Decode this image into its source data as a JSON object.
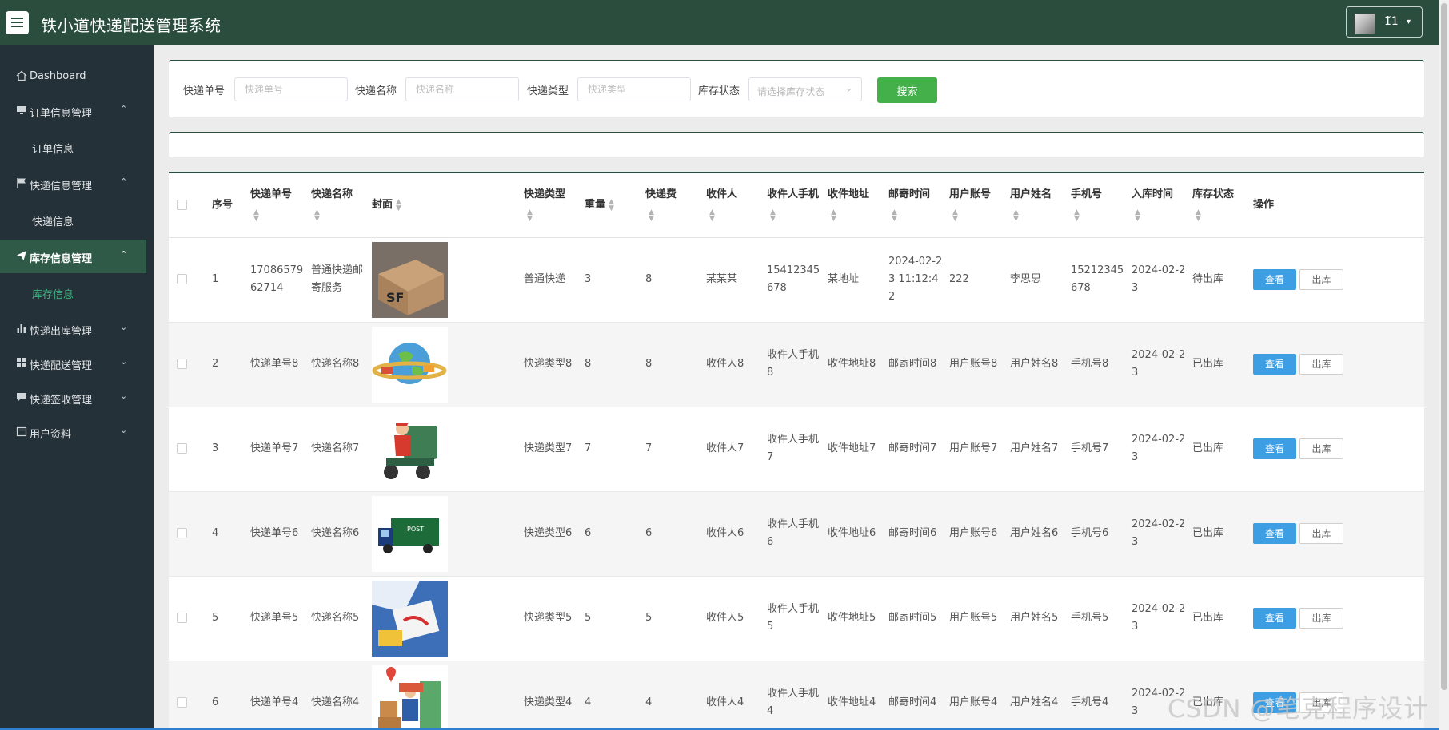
{
  "header": {
    "title": "铁小道快递配送管理系统",
    "user_name": "1̃1",
    "user_caret": "▾"
  },
  "sidebar": {
    "items": [
      {
        "label": "Dashboard",
        "icon": "home-icon"
      },
      {
        "label": "订单信息管理",
        "icon": "monitor-icon",
        "expanded": true
      },
      {
        "label": "订单信息",
        "sub": true
      },
      {
        "label": "快递信息管理",
        "icon": "flag-icon",
        "expanded": true
      },
      {
        "label": "快递信息",
        "sub": true
      },
      {
        "label": "库存信息管理",
        "icon": "send-icon",
        "expanded": true,
        "active": true
      },
      {
        "label": "库存信息",
        "sub": true,
        "current": true
      },
      {
        "label": "快递出库管理",
        "icon": "bar-chart-icon"
      },
      {
        "label": "快递配送管理",
        "icon": "grid-icon"
      },
      {
        "label": "快递签收管理",
        "icon": "comment-icon"
      },
      {
        "label": "用户资料",
        "icon": "calendar-icon"
      }
    ],
    "chevron_up": "⌃",
    "chevron_down": "⌄"
  },
  "search": {
    "fields": [
      {
        "label": "快递单号",
        "placeholder": "快递单号"
      },
      {
        "label": "快递名称",
        "placeholder": "快递名称"
      },
      {
        "label": "快递类型",
        "placeholder": "快递类型"
      }
    ],
    "status_label": "库存状态",
    "status_placeholder": "请选择库存状态",
    "button": "搜索"
  },
  "table": {
    "columns": [
      "序号",
      "快递单号",
      "快递名称",
      "封面",
      "快递类型",
      "重量",
      "快递费",
      "收件人",
      "收件人手机",
      "收件地址",
      "邮寄时间",
      "用户账号",
      "用户姓名",
      "手机号",
      "入库时间",
      "库存状态",
      "操作"
    ],
    "view_label": "查看",
    "out_label": "出库",
    "rows": [
      {
        "no": "1",
        "code": "1708657962714",
        "name": "普通快递邮寄服务",
        "cover": "sf-box",
        "type": "普通快递",
        "weight": "3",
        "fee": "8",
        "receiver": "某某某",
        "phone": "15412345678",
        "address": "某地址",
        "send_time": "2024-02-23 11:12:42",
        "account": "222",
        "user_name": "李思思",
        "mobile": "15212345678",
        "in_time": "2024-02-23",
        "status": "待出库"
      },
      {
        "no": "2",
        "code": "快递单号8",
        "name": "快递名称8",
        "cover": "globe-delivery",
        "type": "快递类型8",
        "weight": "8",
        "fee": "8",
        "receiver": "收件人8",
        "phone": "收件人手机8",
        "address": "收件地址8",
        "send_time": "邮寄时间8",
        "account": "用户账号8",
        "user_name": "用户姓名8",
        "mobile": "手机号8",
        "in_time": "2024-02-23",
        "status": "已出库"
      },
      {
        "no": "3",
        "code": "快递单号7",
        "name": "快递名称7",
        "cover": "courier-tricycle",
        "type": "快递类型7",
        "weight": "7",
        "fee": "7",
        "receiver": "收件人7",
        "phone": "收件人手机7",
        "address": "收件地址7",
        "send_time": "邮寄时间7",
        "account": "用户账号7",
        "user_name": "用户姓名7",
        "mobile": "手机号7",
        "in_time": "2024-02-23",
        "status": "已出库"
      },
      {
        "no": "4",
        "code": "快递单号6",
        "name": "快递名称6",
        "cover": "postal-truck",
        "type": "快递类型6",
        "weight": "6",
        "fee": "6",
        "receiver": "收件人6",
        "phone": "收件人手机6",
        "address": "收件地址6",
        "send_time": "邮寄时间6",
        "account": "用户账号6",
        "user_name": "用户姓名6",
        "mobile": "手机号6",
        "in_time": "2024-02-23",
        "status": "已出库"
      },
      {
        "no": "5",
        "code": "快递单号5",
        "name": "快递名称5",
        "cover": "packaging-print",
        "type": "快递类型5",
        "weight": "5",
        "fee": "5",
        "receiver": "收件人5",
        "phone": "收件人手机5",
        "address": "收件地址5",
        "send_time": "邮寄时间5",
        "account": "用户账号5",
        "user_name": "用户姓名5",
        "mobile": "手机号5",
        "in_time": "2024-02-23",
        "status": "已出库"
      },
      {
        "no": "6",
        "code": "快递单号4",
        "name": "快递名称4",
        "cover": "courier-boxes",
        "type": "快递类型4",
        "weight": "4",
        "fee": "4",
        "receiver": "收件人4",
        "phone": "收件人手机4",
        "address": "收件地址4",
        "send_time": "邮寄时间4",
        "account": "用户账号4",
        "user_name": "用户姓名4",
        "mobile": "手机号4",
        "in_time": "2024-02-23",
        "status": "已出库"
      }
    ]
  },
  "watermark": "CSDN @笔克程序设计",
  "colors": {
    "header": "#2a4d3e",
    "sidebar": "#253139",
    "sidebar_active": "#2e5a47",
    "accent_green": "#43b04a",
    "view_button": "#3e9ee3"
  }
}
